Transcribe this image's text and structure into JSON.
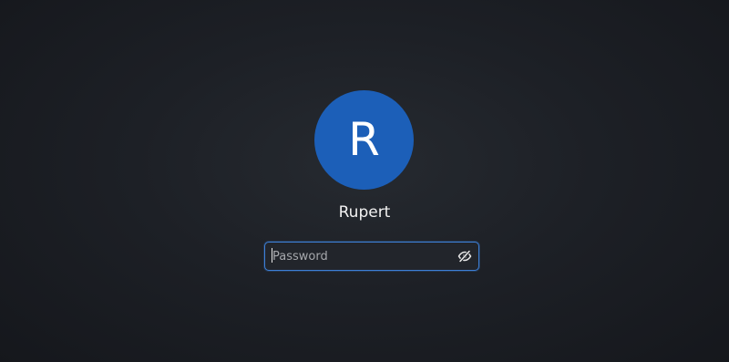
{
  "lock_screen": {
    "user": {
      "initial": "R",
      "name": "Rupert",
      "avatar_color": "#1c5fb8"
    },
    "password": {
      "value": "",
      "placeholder": "Password",
      "reveal_icon": "eye-slash-icon",
      "focused": true,
      "focus_color": "#3d7fd6"
    }
  }
}
